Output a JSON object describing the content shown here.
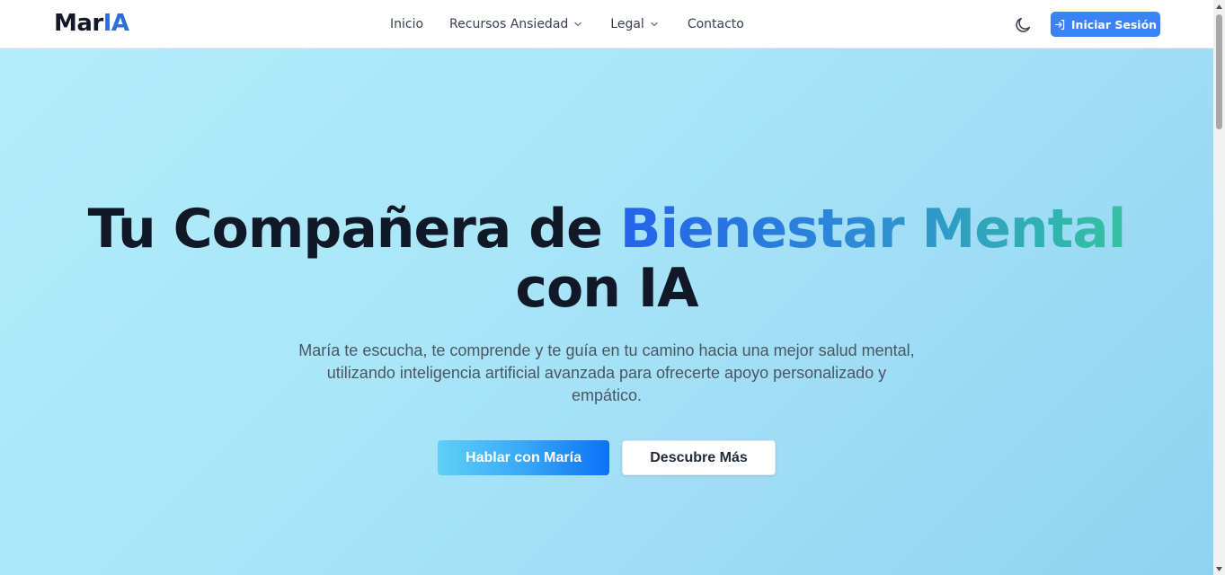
{
  "header": {
    "logo_part1": "Mar",
    "logo_part2": "IA",
    "nav": [
      {
        "label": "Inicio"
      },
      {
        "label": "Recursos Ansiedad"
      },
      {
        "label": "Legal"
      },
      {
        "label": "Contacto"
      }
    ],
    "theme_toggle_icon": "moon-icon",
    "login_label": "Iniciar Sesión",
    "login_icon": "login-arrow-icon"
  },
  "hero": {
    "title_line1_plain": "Tu Compañera de ",
    "title_line1_highlight": "Bienestar Mental",
    "title_line2": "con IA",
    "subtitle": "María te escucha, te comprende y te guía en tu camino hacia una mejor salud mental, utilizando inteligencia artificial avanzada para ofrecerte apoyo personalizado y empático.",
    "primary_cta": "Hablar con María",
    "secondary_cta": "Descubre Más"
  },
  "colors": {
    "accent": "#3b82f6",
    "logo_accent": "#2f6fdc",
    "gradient_start": "#2563eb",
    "gradient_end": "#34c2a0",
    "hero_bg": "#a9e6f8"
  }
}
